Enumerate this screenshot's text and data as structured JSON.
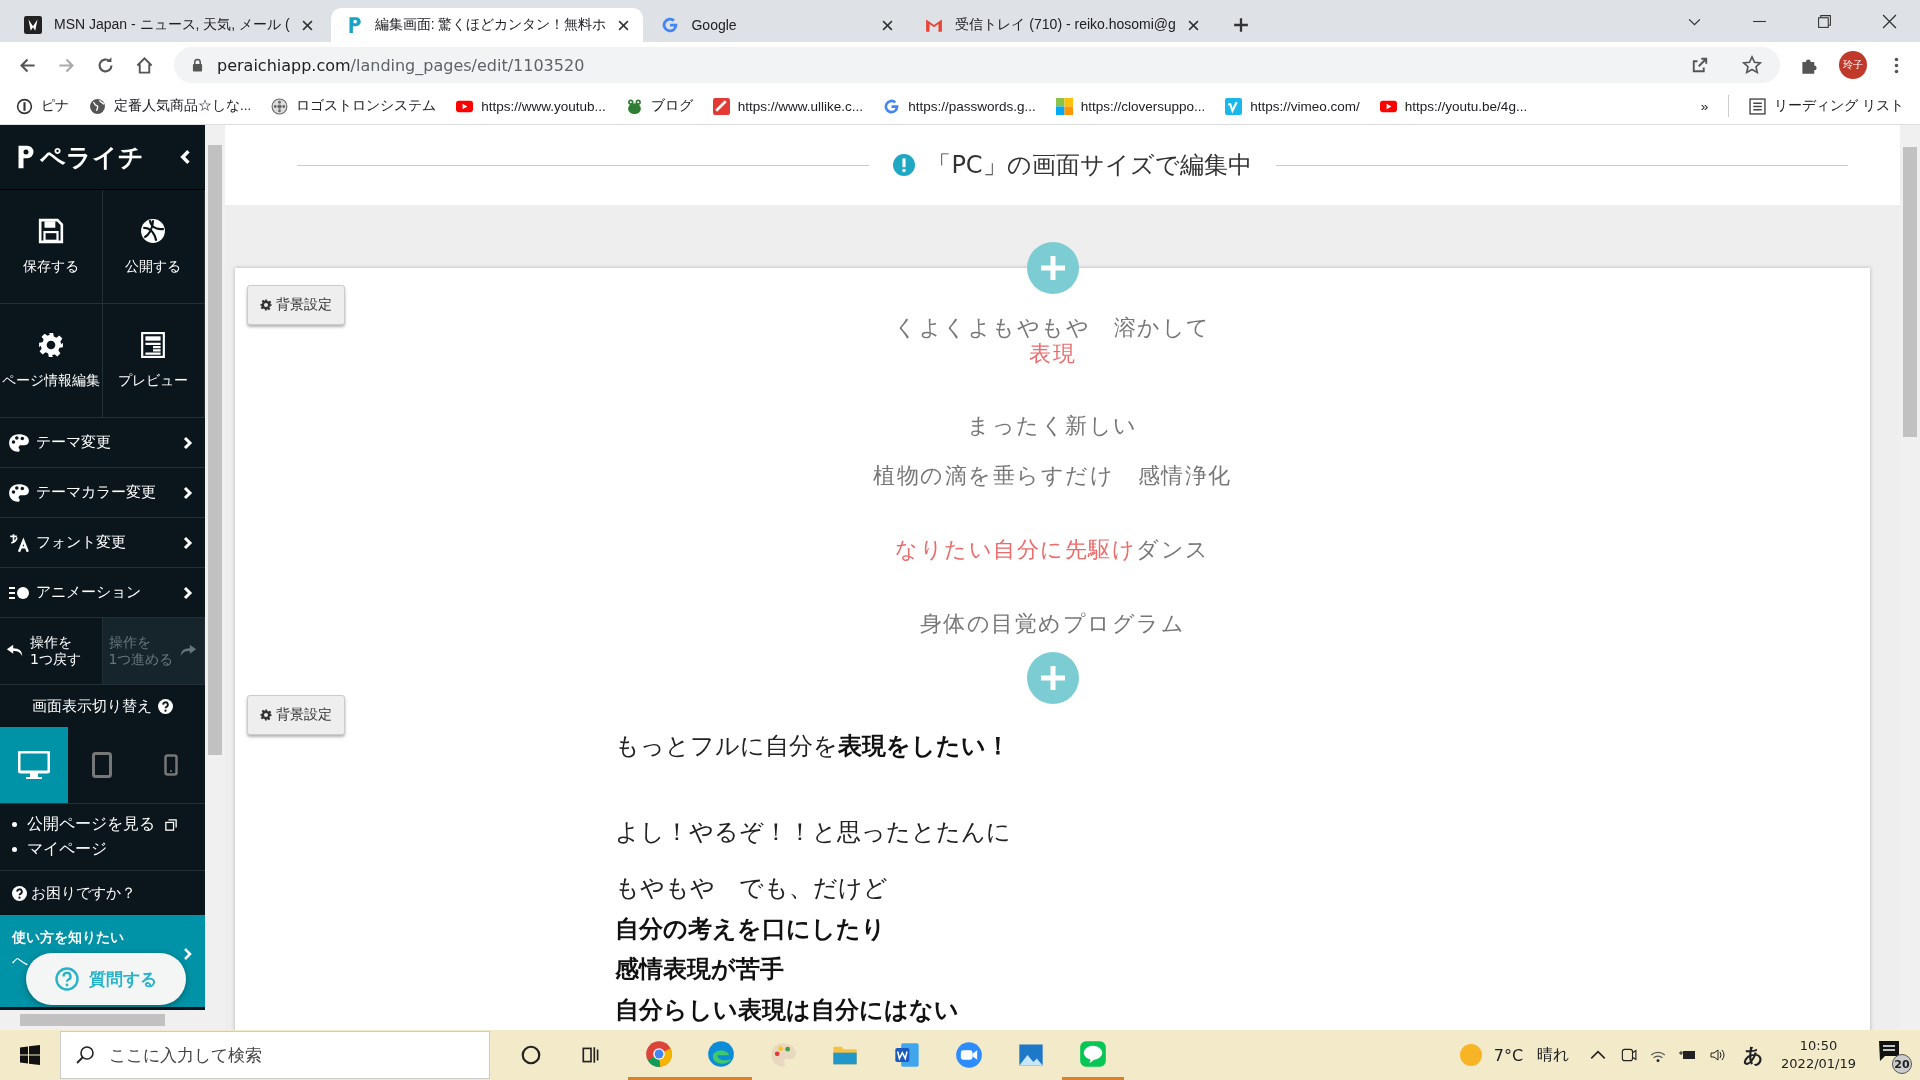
{
  "browser": {
    "tabs": [
      {
        "title": "MSN Japan - ニュース, 天気, メール (",
        "selected": false
      },
      {
        "title": "編集画面: 驚くほどカンタン！無料ホ",
        "selected": true
      },
      {
        "title": "Google",
        "selected": false
      },
      {
        "title": "受信トレイ (710) - reiko.hosomi@g",
        "selected": false
      }
    ],
    "address": {
      "domain": "peraichiapp.com",
      "path": "/landing_pages/edit/1103520"
    },
    "profile": "玲子",
    "bookmarks": [
      "ピナ",
      "定番人気商品☆しな...",
      "ロゴストロンシステム",
      "https://www.youtub...",
      "ブログ",
      "https://www.ullike.c...",
      "https://passwords.g...",
      "https://cloversuppo...",
      "https://vimeo.com/",
      "https://youtu.be/4g..."
    ],
    "overflow": "»",
    "reading_list": "リーディング リスト"
  },
  "sidebar": {
    "logo": "ペライチ",
    "actions": [
      "保存する",
      "公開する",
      "ページ情報編集",
      "プレビュー"
    ],
    "menu": [
      "テーマ変更",
      "テーマカラー変更",
      "フォント変更",
      "アニメーション"
    ],
    "history": [
      {
        "lines": [
          "操作を",
          "1つ戻す"
        ],
        "disabled": false
      },
      {
        "lines": [
          "操作を",
          "1つ進める"
        ],
        "disabled": true
      }
    ],
    "display_switch": {
      "label": "画面表示切り替え",
      "devices": [
        {
          "selected": true
        },
        {
          "selected": false
        },
        {
          "selected": false
        }
      ]
    },
    "links": [
      {
        "label": "公開ページを見る",
        "external": true
      },
      {
        "label": "マイページ"
      }
    ],
    "help": "お困りですか？",
    "banner": {
      "title": "使い方を知りたい",
      "line_2": "へ"
    },
    "ask_button": "質問する"
  },
  "editor": {
    "notice": "「PC」の画面サイズで編集中",
    "sections": [
      {
        "bg_button": "背景設定",
        "lines": [
          [
            {
              "text": "くよくよもやもや　溶かして"
            }
          ],
          [
            {
              "text": "表現",
              "accent": true
            }
          ],
          [
            {
              "text": "まったく新しい"
            }
          ],
          [
            {
              "text": "植物の滴を垂らすだけ　感情浄化"
            }
          ],
          [
            {
              "text": "なりたい自分に先駆け",
              "accent": true
            },
            {
              "text": "ダンス"
            }
          ],
          [
            {
              "text": "身体の目覚めプログラム"
            }
          ]
        ]
      },
      {
        "bg_button": "背景設定",
        "lines": [
          [
            {
              "text": "もっとフルに自分を"
            },
            {
              "text": "表現をしたい！",
              "bold": true
            }
          ],
          [
            {
              "text": "よし！やるぞ！！と思ったとたんに"
            }
          ],
          [
            {
              "text": "もやもや　でも、だけど"
            }
          ],
          [
            {
              "text": "自分の考えを口にしたり",
              "bold": true
            }
          ],
          [
            {
              "text": "感情表現が苦手",
              "bold": true
            }
          ],
          [
            {
              "text": "自分らしい表現は自分にはない",
              "bold": true
            }
          ]
        ]
      }
    ]
  },
  "taskbar": {
    "search_placeholder": "ここに入力して検索",
    "apps": [
      {
        "running": true
      },
      {
        "running": true
      },
      {
        "running": false
      },
      {
        "running": false
      },
      {
        "running": false
      },
      {
        "running": false
      },
      {
        "running": false
      },
      {
        "running": true
      }
    ],
    "temperature": "7°C",
    "weather": "晴れ",
    "ime": "あ",
    "time": "10:50",
    "date": "2022/01/19",
    "notifications": "20"
  }
}
